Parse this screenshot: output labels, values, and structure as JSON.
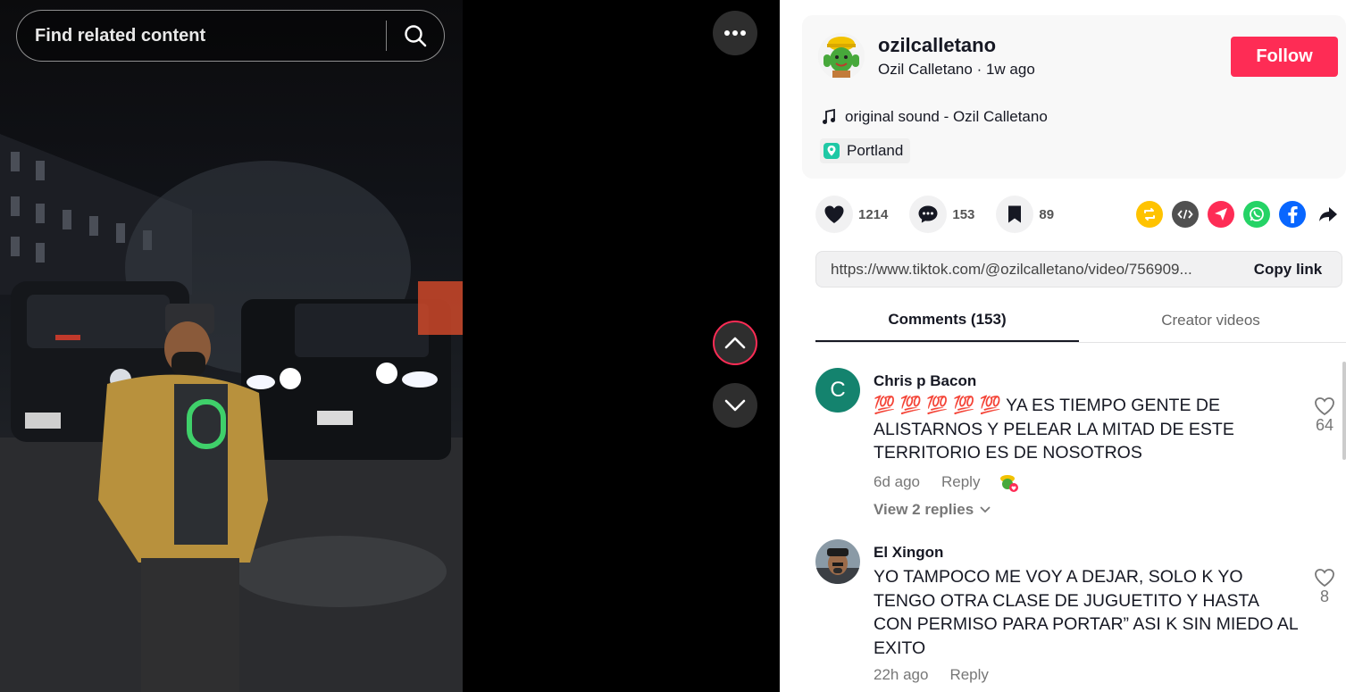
{
  "search": {
    "placeholder": "Find related content"
  },
  "video": {
    "icons": [
      "search-icon",
      "more-icon",
      "chevron-up-icon",
      "chevron-down-icon"
    ]
  },
  "author": {
    "username": "ozilcalletano",
    "display_name": "Ozil Calletano",
    "separator": "·",
    "posted": "1w ago",
    "follow_label": "Follow"
  },
  "sound": {
    "label": "original sound - Ozil Calletano",
    "icon": "music-note-icon"
  },
  "location": {
    "label": "Portland",
    "icon": "location-pin-icon"
  },
  "stats": {
    "likes": "1214",
    "comments": "153",
    "saves": "89"
  },
  "share_icons": [
    "repost-icon",
    "embed-icon",
    "send-icon",
    "whatsapp-icon",
    "facebook-icon",
    "share-arrow-icon"
  ],
  "link": {
    "url": "https://www.tiktok.com/@ozilcalletano/video/756909...",
    "copy_label": "Copy link"
  },
  "tabs": {
    "comments": "Comments (153)",
    "creator_videos": "Creator videos"
  },
  "comments": [
    {
      "avatar_letter": "C",
      "name": "Chris p Bacon",
      "text": "💯 💯 💯 💯 💯 YA ES TIEMPO GENTE DE ALISTARNOS Y PELEAR LA MITAD DE ESTE TERRITORIO ES DE NOSOTROS",
      "time": "6d ago",
      "reply_label": "Reply",
      "likes": "64",
      "view_replies": "View 2 replies"
    },
    {
      "name": "El Xingon",
      "text": "YO TAMPOCO ME VOY A DEJAR, SOLO K YO TENGO OTRA CLASE DE JUGUETITO Y HASTA CON PERMISO PARA PORTAR” ASI K SIN MIEDO AL EXITO",
      "time": "22h ago",
      "reply_label": "Reply",
      "likes": "8"
    }
  ],
  "colors": {
    "accent": "#fe2c55",
    "avatar_c": "#14836e",
    "repost": "#ffc300",
    "embed": "#505050",
    "send": "#fe2c55",
    "whatsapp": "#25d366",
    "facebook": "#0866ff"
  }
}
